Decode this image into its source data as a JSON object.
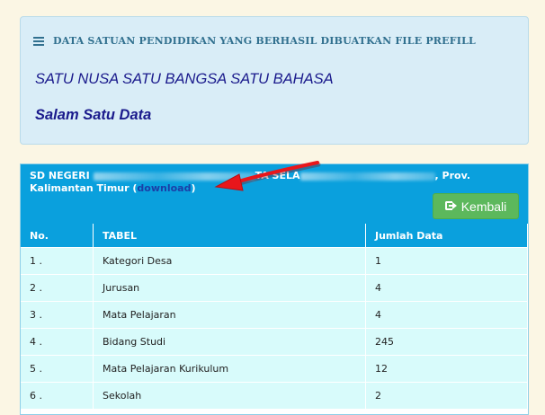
{
  "info_panel": {
    "title": "DATA SATUAN PENDIDIKAN YANG BERHASIL DIBUATKAN FILE PREFILL",
    "motto": "SATU NUSA SATU BANGSA SATU BAHASA",
    "greeting": "Salam Satu Data"
  },
  "school_header": {
    "prefix": "SD NEGERI",
    "suffix": "TA SELA",
    "province": ", Prov. Kalimantan Timur (",
    "download_label": "download",
    "close_paren": ")"
  },
  "back_button": {
    "label": "Kembali"
  },
  "table": {
    "columns": [
      "No.",
      "TABEL",
      "Jumlah Data"
    ],
    "rows": [
      {
        "no": "1 .",
        "tabel": "Kategori Desa",
        "jumlah": "1"
      },
      {
        "no": "2 .",
        "tabel": "Jurusan",
        "jumlah": "4"
      },
      {
        "no": "3 .",
        "tabel": "Mata Pelajaran",
        "jumlah": "4"
      },
      {
        "no": "4 .",
        "tabel": "Bidang Studi",
        "jumlah": "245"
      },
      {
        "no": "5 .",
        "tabel": "Mata Pelajaran Kurikulum",
        "jumlah": "12"
      },
      {
        "no": "6 .",
        "tabel": "Sekolah",
        "jumlah": "2"
      }
    ]
  },
  "colors": {
    "page_bg": "#fbf6e4",
    "info_bg": "#d9edf7",
    "header_bg": "#0aa0dd",
    "row_bg": "#d8fbfb",
    "button_bg": "#5cb85c",
    "annotation_arrow": "#e8161b"
  }
}
